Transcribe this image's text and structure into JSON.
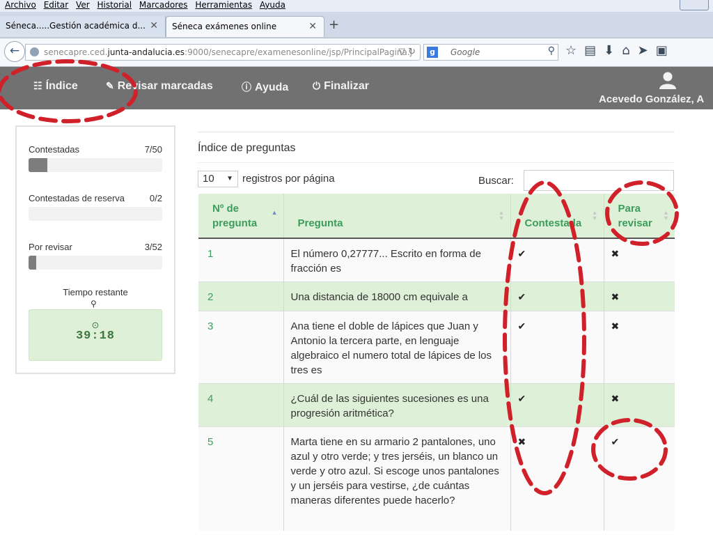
{
  "browser": {
    "menu": [
      "Archivo",
      "Editar",
      "Ver",
      "Historial",
      "Marcadores",
      "Herramientas",
      "Ayuda"
    ],
    "tabs": [
      {
        "label": "Séneca.....Gestión académica d...",
        "active": false
      },
      {
        "label": "Séneca exámenes online",
        "active": true
      }
    ],
    "url_prefix": "senecapre.ced.",
    "url_domain": "junta-andalucia.es",
    "url_path": ":9000/senecapre/examenesonline/jsp/PrincipalPagina.j",
    "search_placeholder": "Google"
  },
  "header": {
    "nav": [
      {
        "label": "Índice",
        "icon": "sitemap-icon"
      },
      {
        "label": "Revisar marcadas",
        "icon": "pencil-icon"
      },
      {
        "label": "Ayuda",
        "icon": "info-icon"
      },
      {
        "label": "Finalizar",
        "icon": "power-icon"
      }
    ],
    "user_name": "Acevedo González, A"
  },
  "sidebar": {
    "stats": [
      {
        "label": "Contestadas",
        "count": "7/50",
        "fraction": 0.14
      },
      {
        "label": "Contestadas de reserva",
        "count": "0/2",
        "fraction": 0
      },
      {
        "label": "Por revisar",
        "count": "3/52",
        "fraction": 0.058
      }
    ],
    "time_label": "Tiempo restante",
    "time_value": "39:18"
  },
  "main": {
    "title": "Índice de preguntas",
    "page_size": "10",
    "per_page_label": "registros por página",
    "search_label": "Buscar:",
    "columns": [
      "Nº de pregunta",
      "Pregunta",
      "Contestada",
      "Para revisar"
    ],
    "rows": [
      {
        "num": "1",
        "question": "El número 0,27777... Escrito en forma de fracción es",
        "answered": "✔",
        "review": "✖"
      },
      {
        "num": "2",
        "question": "Una distancia de 18000 cm equivale a",
        "answered": "✔",
        "review": "✖"
      },
      {
        "num": "3",
        "question": "Ana tiene el doble de lápices que Juan y Antonio la tercera parte, en lenguaje algebraico el numero total de lápices de los tres es",
        "answered": "✔",
        "review": "✖"
      },
      {
        "num": "4",
        "question": "¿Cuál de las siguientes sucesiones es una progresión aritmética?",
        "answered": "✔",
        "review": "✖"
      },
      {
        "num": "5",
        "question": "Marta tiene en su armario 2 pantalones, uno azul y otro verde; y tres jerséis, un blanco un verde y otro azul. Si escoge unos pantalones y un jerséis para vestirse, ¿de cuántas maneras diferentes puede hacerlo?",
        "answered": "✖",
        "review": "✔"
      }
    ]
  },
  "colors": {
    "header_bg": "#717171",
    "accent_green": "#3c9c5c",
    "row_green": "#dff0d8",
    "annotation_red": "#d0202a"
  }
}
